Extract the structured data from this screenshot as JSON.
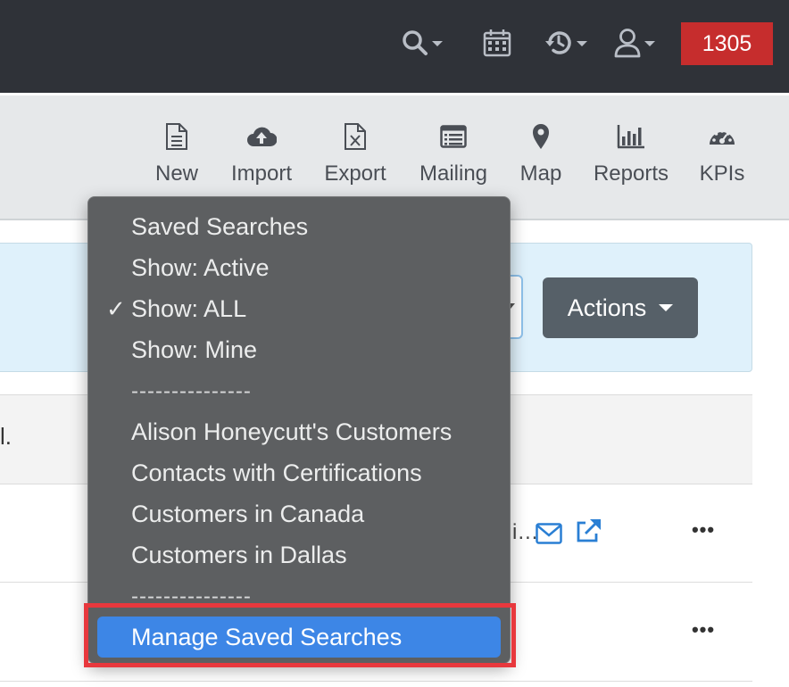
{
  "topbar": {
    "icons": [
      "search-icon",
      "calendar-icon",
      "history-icon",
      "user-icon"
    ],
    "badge": "1305"
  },
  "toolbar": {
    "items": [
      {
        "label": "New",
        "icon": "new-document-icon"
      },
      {
        "label": "Import",
        "icon": "cloud-upload-icon"
      },
      {
        "label": "Export",
        "icon": "excel-file-icon"
      },
      {
        "label": "Mailing",
        "icon": "mailing-list-icon"
      },
      {
        "label": "Map",
        "icon": "map-pin-icon"
      },
      {
        "label": "Reports",
        "icon": "bar-chart-icon"
      },
      {
        "label": "KPIs",
        "icon": "gauge-icon"
      }
    ]
  },
  "filter": {
    "actions_label": "Actions"
  },
  "table": {
    "header_fragment": "l.",
    "rows": [
      {
        "truncated_text": "i…",
        "more": "•••"
      },
      {
        "more": "•••"
      }
    ]
  },
  "dropdown": {
    "items": [
      {
        "label": "Saved Searches",
        "checked": false
      },
      {
        "label": "Show: Active",
        "checked": false
      },
      {
        "label": "Show: ALL",
        "checked": true
      },
      {
        "label": "Show: Mine",
        "checked": false
      },
      {
        "label": "---------------",
        "separator": true
      },
      {
        "label": "Alison Honeycutt's Customers",
        "checked": false
      },
      {
        "label": "Contacts with Certifications",
        "checked": false
      },
      {
        "label": "Customers in Canada",
        "checked": false
      },
      {
        "label": "Customers in Dallas",
        "checked": false
      },
      {
        "label": "---------------",
        "separator": true
      },
      {
        "label": "Manage Saved Searches",
        "highlighted": true
      }
    ],
    "check_glyph": "✓"
  },
  "colors": {
    "navbar": "#2f3238",
    "badge": "#c62d2d",
    "toolbar": "#e6e8ea",
    "filter_band": "#dff1fb",
    "actions_button": "#566068",
    "menu_background": "#5d5f61",
    "menu_highlight": "#3d86e6",
    "highlight_frame": "#e8383d",
    "link_blue": "#2a7fd4"
  }
}
